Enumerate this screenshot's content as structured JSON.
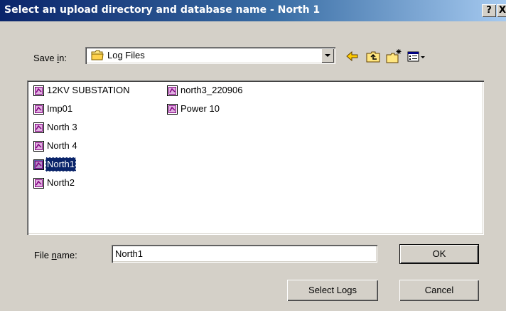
{
  "window": {
    "title": "Select an upload directory and database name - North 1"
  },
  "title_buttons": {
    "help": "?",
    "close": "X"
  },
  "save_in": {
    "label_pre": "Save ",
    "label_ul": "i",
    "label_post": "n:",
    "value": "Log Files"
  },
  "toolbar": {
    "icons": [
      "back-arrow-icon",
      "up-one-level-icon",
      "new-folder-icon",
      "view-menu-icon"
    ]
  },
  "files": [
    {
      "label": "12KV SUBSTATION"
    },
    {
      "label": "Imp01"
    },
    {
      "label": "North 3"
    },
    {
      "label": "North 4"
    },
    {
      "label": "North1",
      "selected": true
    },
    {
      "label": "North2"
    },
    {
      "label": "north3_220906"
    },
    {
      "label": "Power 10"
    }
  ],
  "file_name": {
    "label_pre": "File ",
    "label_ul": "n",
    "label_post": "ame:",
    "value": "North1"
  },
  "buttons": {
    "ok": "OK",
    "cancel": "Cancel",
    "select_logs": "Select Logs"
  },
  "colors": {
    "title_start": "#0a246a",
    "title_end": "#a6caf0",
    "selection": "#0a246a",
    "face": "#d4d0c8",
    "file_icon": "#800080"
  }
}
